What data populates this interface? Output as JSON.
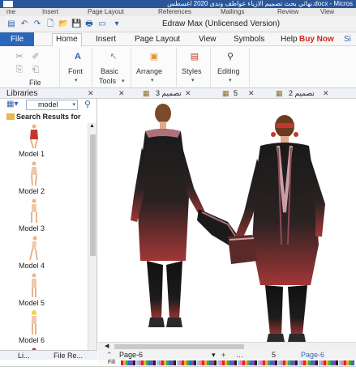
{
  "word_window": {
    "title": "نهائي بحث تصميم الازياء عواطف وندى 2020 اغسطس.docx - Micros",
    "tabs": [
      "me",
      "Insert",
      "Page Layout",
      "References",
      "Mailings",
      "Review",
      "View"
    ]
  },
  "title_bar": {
    "title": "Edraw Max (Unlicensed Version)"
  },
  "menu": {
    "file": "File",
    "tabs": [
      "Home",
      "Insert",
      "Page Layout",
      "View",
      "Symbols",
      "Help"
    ],
    "buy_now": "Buy Now",
    "sign": "Si"
  },
  "ribbon": {
    "file_group_label": "File",
    "font_label": "Font",
    "basic_tools_label_1": "Basic",
    "basic_tools_label_2": "Tools",
    "arrange_label": "Arrange",
    "styles_label": "Styles",
    "editing_label": "Editing"
  },
  "doc_tabs": {
    "libraries": "Libraries",
    "tab1": "تصميم 3",
    "tab2": "5",
    "tab3": "تصميم 2"
  },
  "libraries": {
    "search_value": "model",
    "results_label": "Search Results for",
    "items": [
      "Model 1",
      "Model 2",
      "Model 3",
      "Model 4",
      "Model 5",
      "Model 6"
    ],
    "bottom_tab_1": "Li...",
    "bottom_tab_2": "File Re..."
  },
  "page_bar": {
    "page_name": "Page-6",
    "page_number": "5",
    "current_page": "Page-6",
    "fill_label": "Fill"
  },
  "colors": {
    "file_tab": "#2c66b8",
    "buy_now": "#d6261c",
    "outfit_top": "#1a1a1a",
    "outfit_bottom": "#a23636"
  }
}
